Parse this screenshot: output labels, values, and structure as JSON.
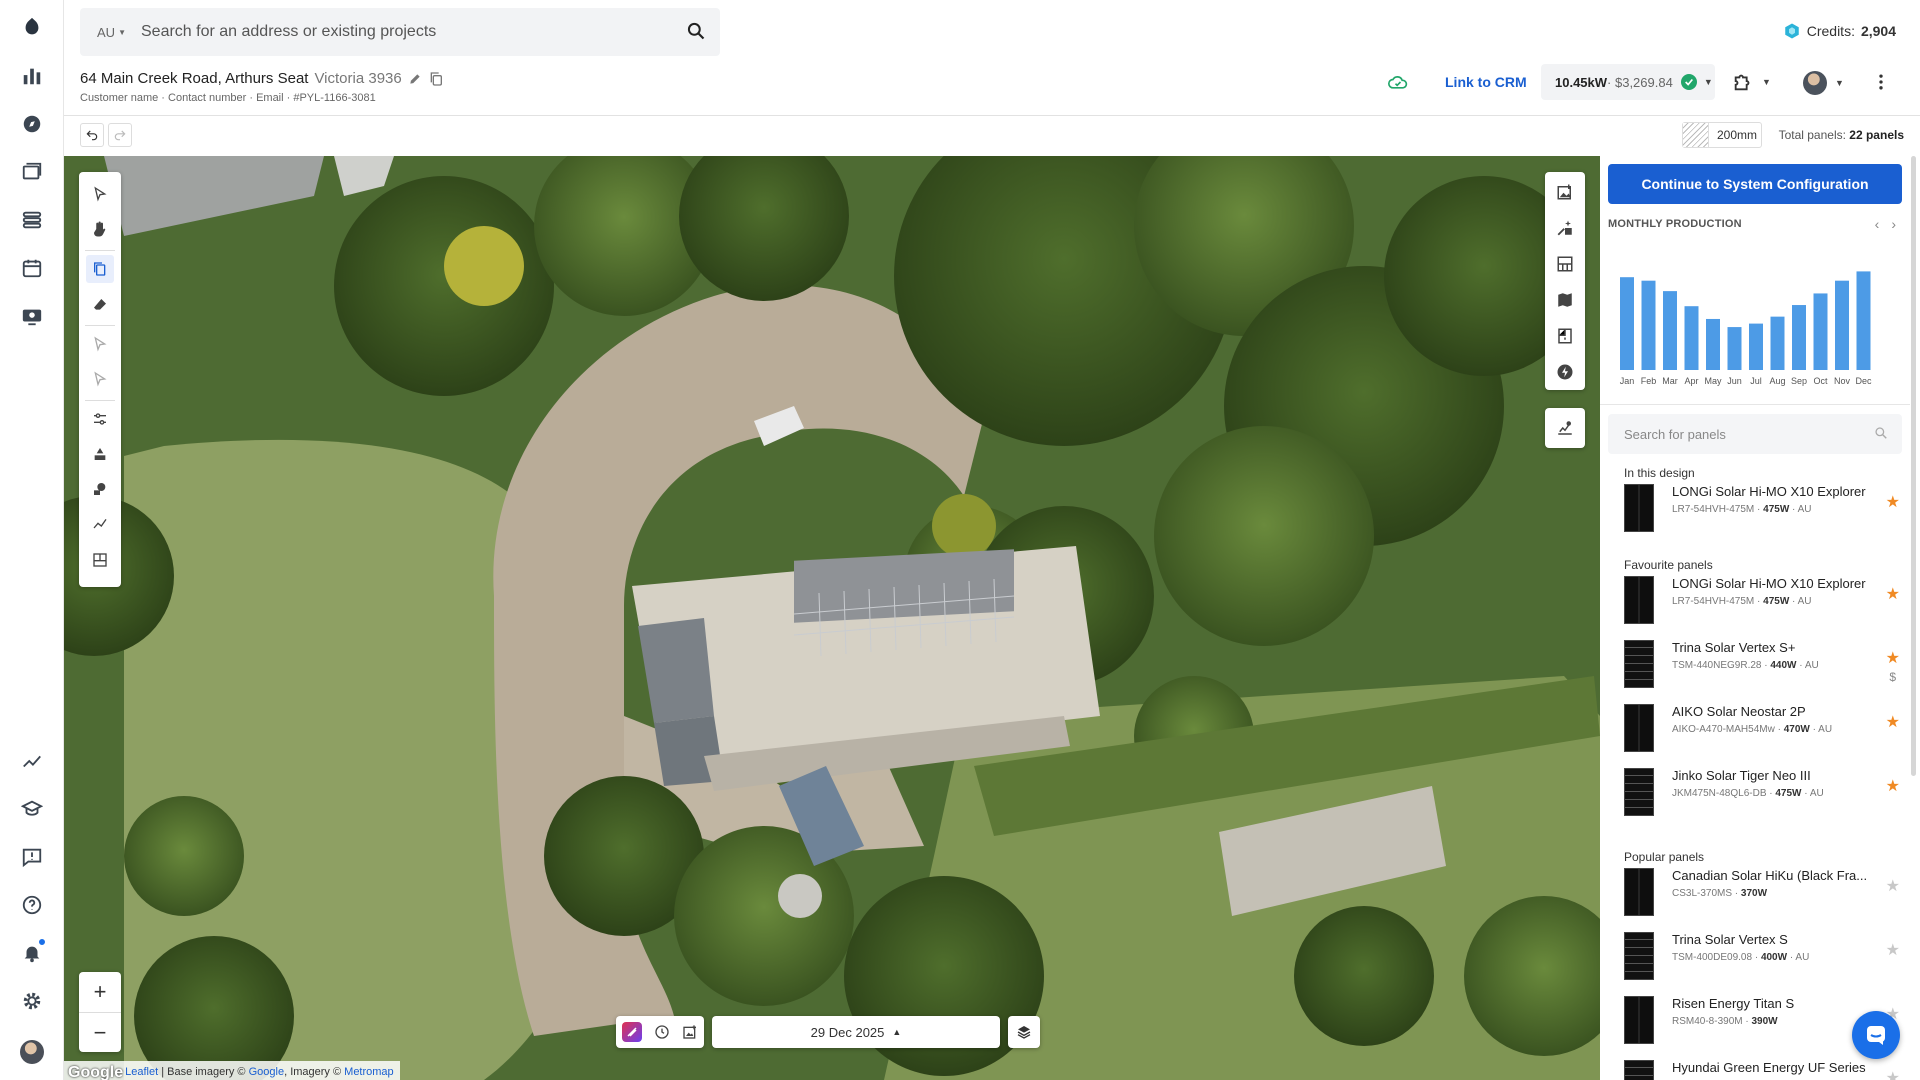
{
  "search": {
    "region": "AU",
    "placeholder": "Search for an address or existing projects"
  },
  "credits": {
    "label": "Credits:",
    "value": "2,904"
  },
  "project": {
    "address": "64 Main Creek Road, Arthurs Seat",
    "state": "Victoria 3936",
    "meta": "Customer name · Contact number · Email · #PYL-1166-3081"
  },
  "header": {
    "link_crm": "Link to CRM",
    "system_kw": "10.45kW",
    "system_price": " · $3,269.84"
  },
  "canvas": {
    "thickness": "200mm",
    "total_label": "Total panels:",
    "total_value": "22 panels"
  },
  "map": {
    "date": "29 Dec 2025",
    "attribution_prefix": "Leaflet",
    "attribution_mid": " | Base imagery © ",
    "attribution_google": "Google",
    "attribution_mid2": ", Imagery © ",
    "attribution_metromap": "Metromap",
    "google_logo": "Google"
  },
  "panel": {
    "continue_label": "Continue to System Configuration",
    "monthly_title": "MONTHLY PRODUCTION",
    "search_placeholder": "Search for panels",
    "sections": {
      "in_design": "In this design",
      "favourite": "Favourite panels",
      "popular": "Popular panels"
    },
    "in_design": [
      {
        "name": "LONGi Solar Hi-MO X10 Explorer",
        "model": "LR7-54HVH-475M",
        "watt": "475W",
        "region": "AU",
        "fav": true
      }
    ],
    "favourites": [
      {
        "name": "LONGi Solar Hi-MO X10 Explorer",
        "model": "LR7-54HVH-475M",
        "watt": "475W",
        "region": "AU",
        "fav": true
      },
      {
        "name": "Trina Solar Vertex S+",
        "model": "TSM-440NEG9R.28",
        "watt": "440W",
        "region": "AU",
        "fav": true,
        "price": "$"
      },
      {
        "name": "AIKO Solar Neostar 2P",
        "model": "AIKO-A470-MAH54Mw",
        "watt": "470W",
        "region": "AU",
        "fav": true
      },
      {
        "name": "Jinko Solar Tiger Neo III",
        "model": "JKM475N-48QL6-DB",
        "watt": "475W",
        "region": "AU",
        "fav": true
      }
    ],
    "popular": [
      {
        "name": "Canadian Solar HiKu (Black Fra...",
        "model": "CS3L-370MS",
        "watt": "370W",
        "region": "",
        "fav": false
      },
      {
        "name": "Trina Solar Vertex S",
        "model": "TSM-400DE09.08",
        "watt": "400W",
        "region": "AU",
        "fav": false
      },
      {
        "name": "Risen Energy Titan S",
        "model": "RSM40-8-390M",
        "watt": "390W",
        "region": "",
        "fav": false
      },
      {
        "name": "Hyundai Green Energy UF Series",
        "model": "",
        "watt": "",
        "region": "",
        "fav": false
      }
    ]
  },
  "chart_data": {
    "type": "bar",
    "title": "MONTHLY PRODUCTION",
    "categories": [
      "Jan",
      "Feb",
      "Mar",
      "Apr",
      "May",
      "Jun",
      "Jul",
      "Aug",
      "Sep",
      "Oct",
      "Nov",
      "Dec"
    ],
    "values": [
      0.8,
      0.77,
      0.68,
      0.55,
      0.44,
      0.37,
      0.4,
      0.46,
      0.56,
      0.66,
      0.77,
      0.85
    ],
    "ylim": [
      0,
      1
    ],
    "color": "#4d9be6",
    "grid": false
  },
  "colors": {
    "accent": "#1a5fd1",
    "star": "#f08a24",
    "success": "#21a66a"
  }
}
